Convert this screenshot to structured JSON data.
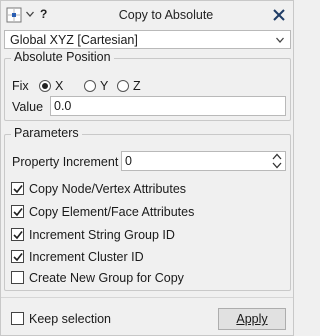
{
  "title_bar": {
    "help_label": "?",
    "title": "Copy to Absolute"
  },
  "coordinate_system": {
    "selected": "Global XYZ [Cartesian]"
  },
  "absolute_position": {
    "title": "Absolute Position",
    "fix_label": "Fix",
    "options": [
      "X",
      "Y",
      "Z"
    ],
    "selected_option": "X",
    "value_label": "Value",
    "value": "0.0"
  },
  "parameters": {
    "title": "Parameters",
    "property_increment_label": "Property Increment",
    "property_increment_value": "0",
    "checkboxes": [
      {
        "label": "Copy Node/Vertex Attributes",
        "checked": true
      },
      {
        "label": "Copy Element/Face Attributes",
        "checked": true
      },
      {
        "label": "Increment String Group ID",
        "checked": true
      },
      {
        "label": "Increment Cluster ID",
        "checked": true
      },
      {
        "label": "Create New Group for Copy",
        "checked": false
      }
    ]
  },
  "footer": {
    "keep_selection_label": "Keep selection",
    "keep_selection_checked": false,
    "apply_label": "Apply"
  }
}
